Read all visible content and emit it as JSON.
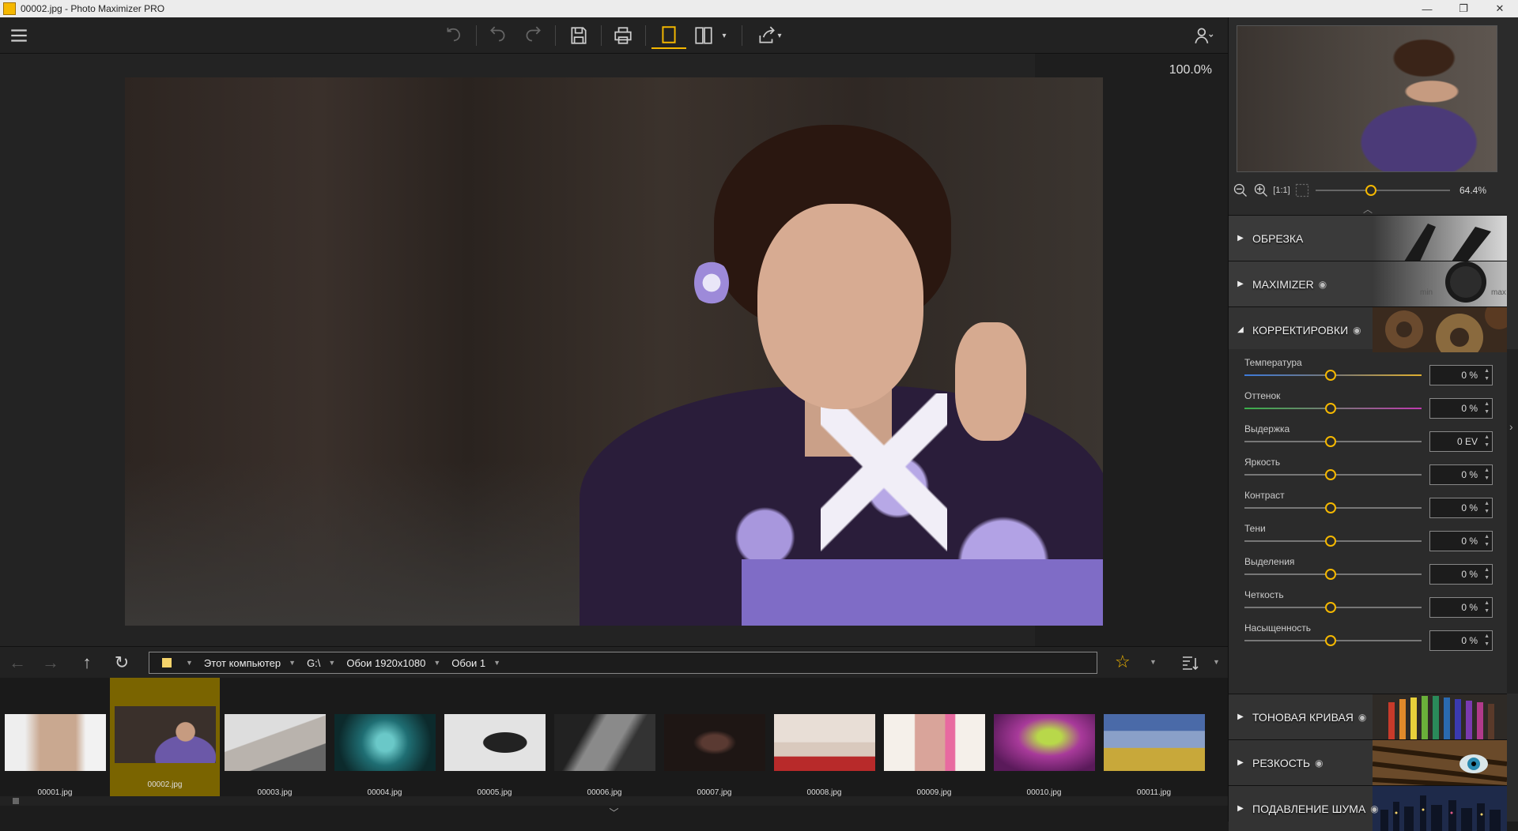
{
  "window": {
    "title": "00002.jpg - Photo Maximizer PRO",
    "minimize": "—",
    "restore": "❐",
    "close": "✕"
  },
  "canvas": {
    "zoom_label": "100.0%"
  },
  "navigator": {
    "zoom_value": "64.4%"
  },
  "sections": {
    "crop": "ОБРЕЗКА",
    "maximizer": "MAXIMIZER",
    "corrections": "КОРРЕКТИРОВКИ",
    "tone_curve": "ТОНОВАЯ КРИВАЯ",
    "sharpness": "РЕЗКОСТЬ",
    "noise": "ПОДАВЛЕНИЕ ШУМА",
    "maximizer_min": "min",
    "maximizer_max": "max"
  },
  "adjustments": [
    {
      "name": "Температура",
      "value": "0 %"
    },
    {
      "name": "Оттенок",
      "value": "0 %"
    },
    {
      "name": "Выдержка",
      "value": "0 EV"
    },
    {
      "name": "Яркость",
      "value": "0 %"
    },
    {
      "name": "Контраст",
      "value": "0 %"
    },
    {
      "name": "Тени",
      "value": "0 %"
    },
    {
      "name": "Выделения",
      "value": "0 %"
    },
    {
      "name": "Четкость",
      "value": "0 %"
    },
    {
      "name": "Насыщенность",
      "value": "0 %"
    }
  ],
  "path": {
    "segments": [
      "Этот компьютер",
      "G:\\",
      "Обои 1920x1080",
      "Обои 1"
    ]
  },
  "thumbnails": [
    {
      "name": "00001.jpg",
      "color": "#c9a890"
    },
    {
      "name": "00002.jpg",
      "color": "#4a3a55"
    },
    {
      "name": "00003.jpg",
      "color": "#b9b3ad"
    },
    {
      "name": "00004.jpg",
      "color": "#1f6e73"
    },
    {
      "name": "00005.jpg",
      "color": "#e3e3e3"
    },
    {
      "name": "00006.jpg",
      "color": "#5a5a5a"
    },
    {
      "name": "00007.jpg",
      "color": "#1e1614"
    },
    {
      "name": "00008.jpg",
      "color": "#8a5a4a"
    },
    {
      "name": "00009.jpg",
      "color": "#d9a49a"
    },
    {
      "name": "00010.jpg",
      "color": "#a83a9a"
    },
    {
      "name": "00011.jpg",
      "color": "#8a9a4a"
    }
  ],
  "colors": {
    "accent": "#f5b800"
  }
}
